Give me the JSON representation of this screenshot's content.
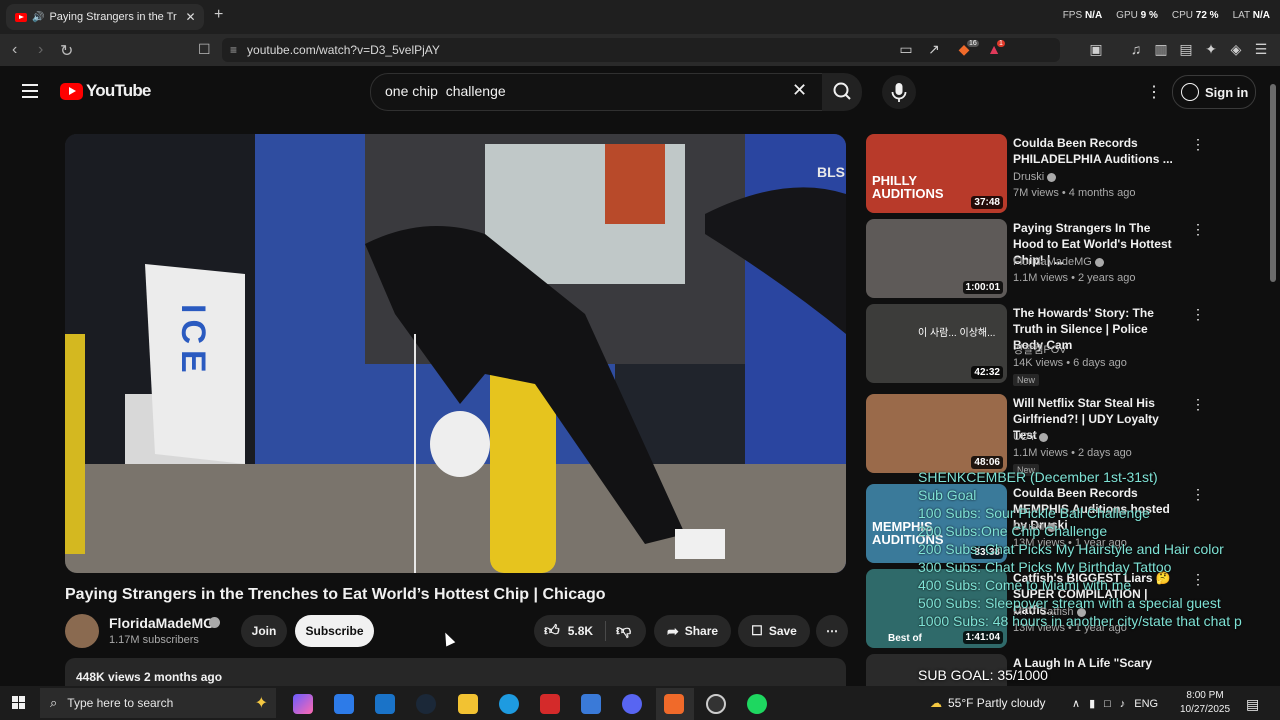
{
  "browser": {
    "tab_title": "Paying Strangers in the Trenches",
    "url": "youtube.com/watch?v=D3_5velPjAY",
    "shields_count": "16",
    "alert_count": "1",
    "perf": {
      "fps_label": "FPS",
      "fps_value": "N/A",
      "gpu_label": "GPU",
      "gpu_value": "9 %",
      "cpu_label": "CPU",
      "cpu_value": "72 %",
      "lat_label": "LAT",
      "lat_value": "N/A"
    }
  },
  "youtube": {
    "logo_text": "YouTube",
    "search_value": "one chip  challenge",
    "sign_in": "Sign in"
  },
  "video": {
    "title": "Paying Strangers in the Trenches to Eat World’s Hottest Chip | Chicago",
    "channel": "FloridaMadeMG",
    "subscribers": "1.17M subscribers",
    "join": "Join",
    "subscribe": "Subscribe",
    "likes": "5.8K",
    "share": "Share",
    "save": "Save",
    "views_date": "448K views  2 months ago",
    "scene_text": {
      "ice": "ICE",
      "sign": "BLS"
    }
  },
  "sidebar": [
    {
      "title": "Coulda Been Records PHILADELPHIA Auditions ...",
      "channel": "Druski",
      "verified": true,
      "meta": "7M views • 4 months ago",
      "duration": "37:48",
      "thumb_text": "PHILLY AUDITIONS",
      "color": "#b83a2a"
    },
    {
      "title": "Paying Strangers In The Hood to Eat World's Hottest Chip! | ...",
      "channel": "FloridaMadeMG",
      "verified": true,
      "meta": "1.1M views • 2 years ago",
      "duration": "1:00:01",
      "thumb_text": "",
      "color": "#5e5a58"
    },
    {
      "title": "The Howards' Story: The Truth in Silence | Police Body Cam",
      "channel": "경찰캠POV",
      "verified": false,
      "meta": "14K views • 6 days ago",
      "duration": "42:32",
      "badge": "New",
      "thumb_text": "이 사람... 이상해...",
      "color": "#3c3c3a"
    },
    {
      "title": "Will Netflix Star Steal His Girlfriend?! | UDY Loyalty Test",
      "channel": "UDY",
      "verified": true,
      "meta": "1.1M views • 2 days ago",
      "duration": "48:06",
      "badge": "New",
      "thumb_text": "",
      "color": "#9a6a4a"
    },
    {
      "title": "Coulda Been Records MEMPHIS Auditions hosted by Druski",
      "channel": "Druski",
      "verified": true,
      "meta": "13M views • 1 year ago",
      "duration": "33:38",
      "thumb_text": "MEMPHIS AUDITIONS",
      "color": "#3a7a9a"
    },
    {
      "title": "Catfish's BIGGEST Liars 🤔 SUPER COMPILATION | Catfis...",
      "channel": "MTV Catfish",
      "verified": true,
      "meta": "13M views • 1 year ago",
      "duration": "1:41:04",
      "thumb_text": "Best of",
      "color": "#2f6a6a"
    },
    {
      "title": "A Laugh In A Life \"Scary",
      "channel": "",
      "verified": false,
      "meta": "",
      "duration": "",
      "thumb_text": "",
      "color": "#2a2a2a"
    }
  ],
  "overlay": {
    "lines": [
      "SHENKCEMBER (December 1st-31st)",
      "Sub Goal",
      "100 Subs: Sour Pickle Ball Challenge",
      "200 Subs:One Chip Challenge",
      "200 Subs: Chat Picks My Hairstyle and Hair color",
      "300 Subs: Chat Picks My Birthday Tattoo",
      "400 Subs: Come to Miami with me",
      "500 Subs: Sleepover stream with a special guest",
      "1000 Subs: 48 hours in another city/state that chat p"
    ],
    "sub_goal": "SUB GOAL: 35/1000"
  },
  "taskbar": {
    "search_placeholder": "Type here to search",
    "weather": "55°F  Partly cloudy",
    "lang": "ENG",
    "time": "8:00 PM",
    "date": "10/27/2025"
  },
  "colors": {
    "accent_red": "#ff0000",
    "overlay_text": "#7fe3d6",
    "bg": "#0f0f0f"
  }
}
